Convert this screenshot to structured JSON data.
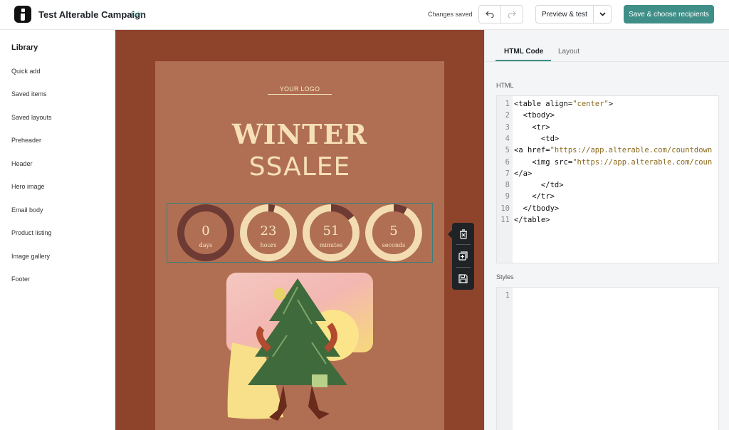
{
  "app": {
    "campaign_title": "Test Alterable Campaign",
    "edit_label": "Edit",
    "status": "Changes saved",
    "preview_label": "Preview & test",
    "save_label": "Save & choose recipients"
  },
  "library": {
    "title": "Library",
    "items": [
      "Quick add",
      "Saved items",
      "Saved layouts",
      "Preheader",
      "Header",
      "Hero image",
      "Email body",
      "Product listing",
      "Image gallery",
      "Footer"
    ]
  },
  "email": {
    "logo_text": "YOUR LOGO",
    "headline_1": "WINTER",
    "headline_2": "SSALEE",
    "countdown": [
      {
        "value": "0",
        "label": "days",
        "progress": 0.0
      },
      {
        "value": "23",
        "label": "hours",
        "progress": 0.96
      },
      {
        "value": "51",
        "label": "minutes",
        "progress": 0.85
      },
      {
        "value": "5",
        "label": "seconds",
        "progress": 0.92
      }
    ],
    "colors": {
      "background": "#8e432b",
      "card": "#b06f52",
      "text": "#f6e0b8",
      "ring_track": "#6e3a34",
      "ring_fill": "#f3dcb0"
    }
  },
  "panel": {
    "tabs": [
      "HTML Code",
      "Layout"
    ],
    "active_tab": "HTML Code",
    "html_label": "HTML",
    "styles_label": "Styles",
    "html_lines": [
      {
        "n": "1",
        "pre": "<table align=",
        "str": "\"center\"",
        "post": ">"
      },
      {
        "n": "2",
        "pre": "  <tbody>",
        "str": "",
        "post": ""
      },
      {
        "n": "3",
        "pre": "    <tr>",
        "str": "",
        "post": ""
      },
      {
        "n": "4",
        "pre": "      <td>",
        "str": "",
        "post": ""
      },
      {
        "n": "5",
        "pre": "<a href=",
        "str": "\"https://app.alterable.com/countdown",
        "post": ""
      },
      {
        "n": "6",
        "pre": "    <img src=",
        "str": "\"https://app.alterable.com/coun",
        "post": ""
      },
      {
        "n": "7",
        "pre": "</a>",
        "str": "",
        "post": ""
      },
      {
        "n": "8",
        "pre": "      </td>",
        "str": "",
        "post": ""
      },
      {
        "n": "9",
        "pre": "    </tr>",
        "str": "",
        "post": ""
      },
      {
        "n": "10",
        "pre": "  </tbody>",
        "str": "",
        "post": ""
      },
      {
        "n": "11",
        "pre": "</table>",
        "str": "",
        "post": ""
      }
    ],
    "styles_lines": [
      {
        "n": "1",
        "pre": "",
        "str": "",
        "post": ""
      }
    ]
  },
  "accent_color": "#3f8f88"
}
